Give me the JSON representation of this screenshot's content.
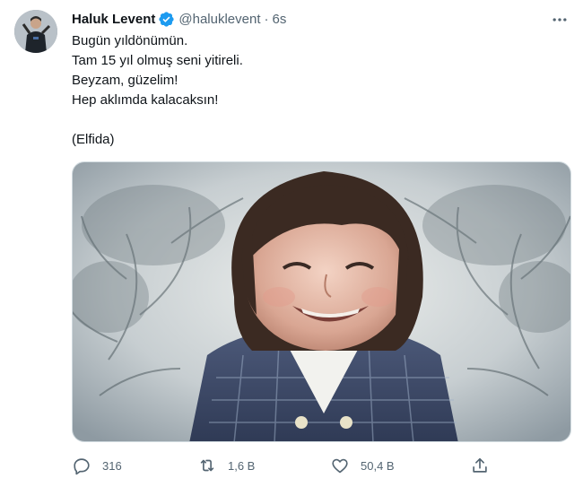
{
  "author": {
    "name": "Haluk Levent",
    "handle": "@haluklevent",
    "separator": "·",
    "time": "6s",
    "verified": true
  },
  "tweet": {
    "lines": [
      "Bugün yıldönümün.",
      "Tam 15 yıl olmuş seni yitireli.",
      "Beyzam, güzelim!",
      "Hep aklımda kalacaksın!",
      "",
      "(Elfida)"
    ]
  },
  "actions": {
    "reply_count": "316",
    "retweet_count": "1,6 B",
    "like_count": "50,4 B"
  },
  "colors": {
    "text": "#0f1419",
    "secondary": "#536471",
    "verified": "#1d9bf0"
  }
}
